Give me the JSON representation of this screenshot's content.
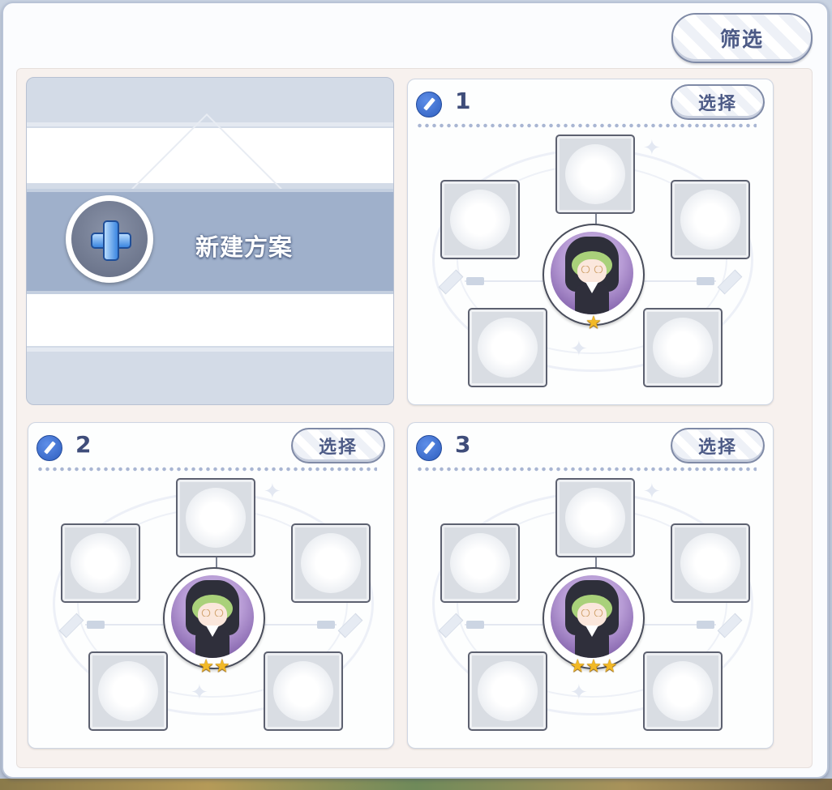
{
  "filter_label": "筛选",
  "new_plan": {
    "label": "新建方案",
    "icon": "plus-icon"
  },
  "plans": [
    {
      "number": "1",
      "select_label": "选择",
      "leader_stars": 1
    },
    {
      "number": "2",
      "select_label": "选择",
      "leader_stars": 2
    },
    {
      "number": "3",
      "select_label": "选择",
      "leader_stars": 3
    }
  ],
  "icons": {
    "edit": "pencil-icon",
    "slot": "empty-slot-icon",
    "star": "star-icon"
  },
  "colors": {
    "accent": "#4c5a86",
    "edit": "#2f5fbf",
    "star": "#f2b927",
    "band": "#9fb0cb"
  }
}
